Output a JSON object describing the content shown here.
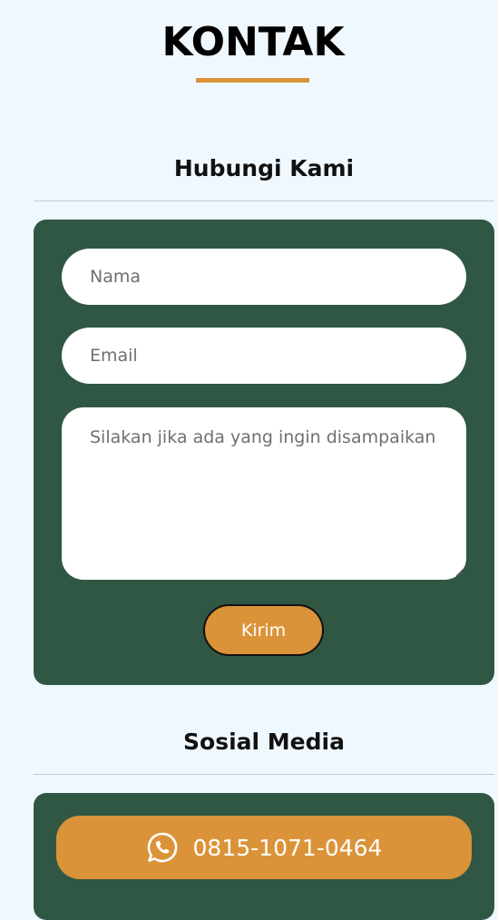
{
  "page": {
    "title": "KONTAK"
  },
  "contact_section": {
    "heading": "Hubungi Kami",
    "form": {
      "name_placeholder": "Nama",
      "email_placeholder": "Email",
      "message_placeholder": "Silakan jika ada yang ingin disampaikan",
      "submit_label": "Kirim"
    }
  },
  "social_section": {
    "heading": "Sosial Media",
    "whatsapp": {
      "icon": "whatsapp-icon",
      "number": "0815-1071-0464"
    }
  },
  "colors": {
    "background": "#f0f8ff",
    "card": "#305744",
    "accent": "#db9339"
  }
}
